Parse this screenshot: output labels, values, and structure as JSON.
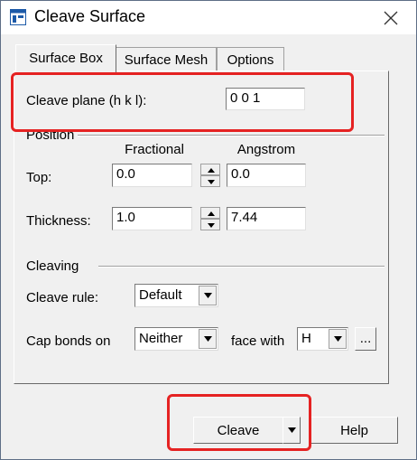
{
  "window": {
    "title": "Cleave Surface",
    "app_icon": "window-icon",
    "close_icon": "close-icon"
  },
  "tabs": [
    {
      "label": "Surface Box",
      "active": true
    },
    {
      "label": "Surface Mesh",
      "active": false
    },
    {
      "label": "Options",
      "active": false
    }
  ],
  "cleave_plane": {
    "label": "Cleave plane (h k l):",
    "value": "0  0  1"
  },
  "position": {
    "group_label": "Position",
    "col_fractional": "Fractional",
    "col_angstrom": "Angstrom",
    "top": {
      "label": "Top:",
      "fractional": "0.0",
      "angstrom": "0.0"
    },
    "thickness": {
      "label": "Thickness:",
      "fractional": "1.0",
      "angstrom": "7.44"
    }
  },
  "cleaving": {
    "group_label": "Cleaving",
    "rule_label": "Cleave rule:",
    "rule_value": "Default",
    "cap_label": "Cap bonds on",
    "cap_value": "Neither",
    "face_with_label": "face with",
    "face_with_value": "H",
    "browse_label": "..."
  },
  "buttons": {
    "cleave": "Cleave",
    "help": "Help"
  },
  "highlight_color": "#e52222"
}
